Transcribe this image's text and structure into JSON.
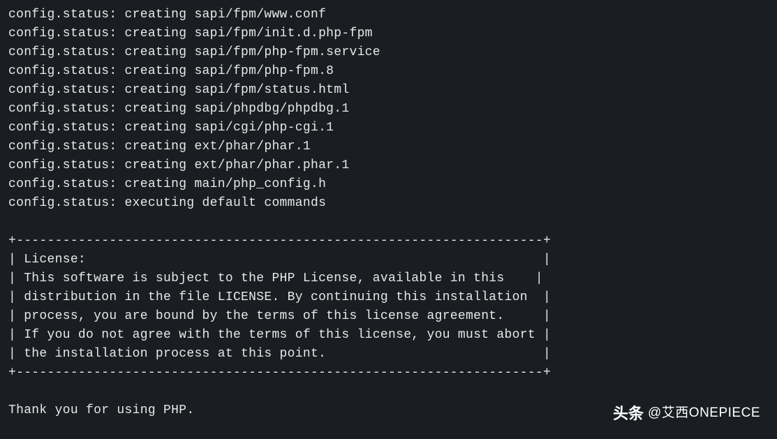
{
  "terminal": {
    "lines": [
      "config.status: creating sapi/fpm/www.conf",
      "config.status: creating sapi/fpm/init.d.php-fpm",
      "config.status: creating sapi/fpm/php-fpm.service",
      "config.status: creating sapi/fpm/php-fpm.8",
      "config.status: creating sapi/fpm/status.html",
      "config.status: creating sapi/phpdbg/phpdbg.1",
      "config.status: creating sapi/cgi/php-cgi.1",
      "config.status: creating ext/phar/phar.1",
      "config.status: creating ext/phar/phar.phar.1",
      "config.status: creating main/php_config.h",
      "config.status: executing default commands",
      "",
      "+--------------------------------------------------------------------+",
      "| License:                                                           |",
      "| This software is subject to the PHP License, available in this    |",
      "| distribution in the file LICENSE. By continuing this installation  |",
      "| process, you are bound by the terms of this license agreement.     |",
      "| If you do not agree with the terms of this license, you must abort |",
      "| the installation process at this point.                            |",
      "+--------------------------------------------------------------------+",
      "",
      "Thank you for using PHP."
    ]
  },
  "watermark": {
    "brand": "头条",
    "user": "@艾西ONEPIECE"
  }
}
